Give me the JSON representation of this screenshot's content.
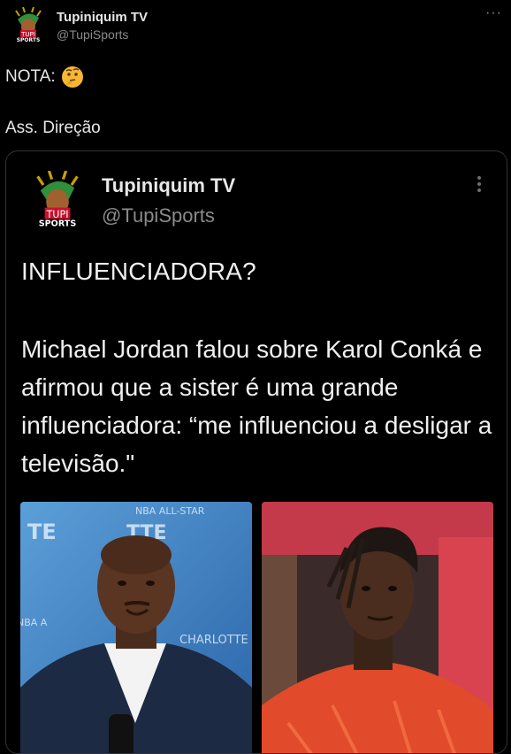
{
  "tweet": {
    "author_name": "Tupiniquim TV",
    "author_handle": "@TupiSports",
    "more_label": "···",
    "lines": [
      "NOTA:",
      "Ass. Direção"
    ],
    "emoji": "thinking-face"
  },
  "quoted": {
    "author_name": "Tupiniquim TV",
    "author_handle": "@TupiSports",
    "headline": "INFLUENCIADORA?",
    "body": "Michael Jordan falou sobre Karol Conká e afirmou que a sister é uma grande influenciadora: “me influenciou a desligar a televisão.\"",
    "photo_left_text": {
      "line1": "NBA ALL-STAR",
      "line2": "CHARLOTTE",
      "ticker": "NBA A"
    },
    "photo_right_text": {}
  },
  "avatar": {
    "logo_text_top": "TUPI",
    "logo_text_bottom": "SPORTS"
  },
  "colors": {
    "background": "#000000",
    "text_primary": "#e7e7e7",
    "text_secondary": "#8b8b8b",
    "card_border": "#2f3336"
  }
}
